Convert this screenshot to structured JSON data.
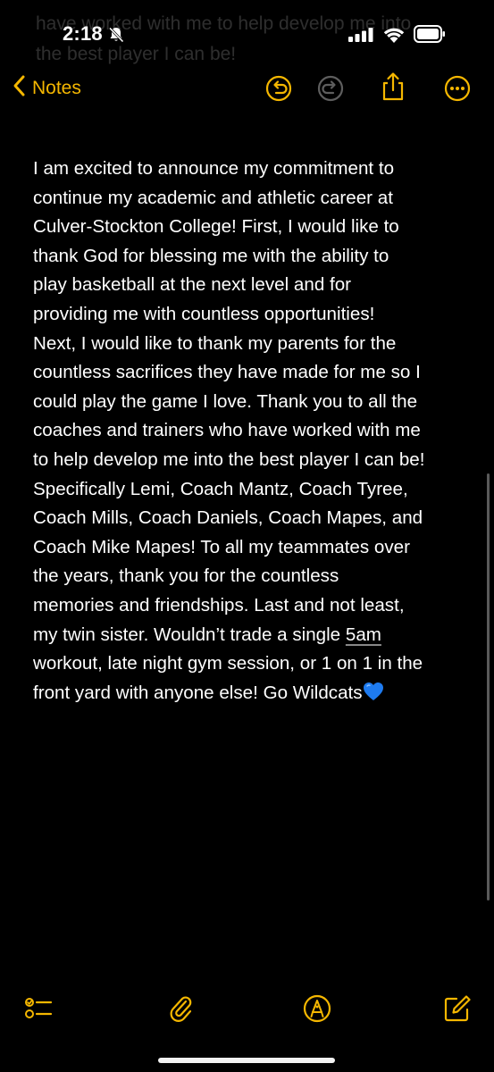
{
  "status_bar": {
    "time": "2:18"
  },
  "ghost_text": {
    "line1": "have worked with me to help develop me into",
    "line2": "the best player I can be!"
  },
  "nav": {
    "back_label": "Notes",
    "icons": [
      "undo-icon",
      "redo-icon",
      "share-icon",
      "more-icon"
    ]
  },
  "note": {
    "lines": [
      "I am excited to announce my commitment to",
      "continue my academic and athletic career at",
      "Culver-Stockton College! First, I would like to",
      "thank God for blessing me with the ability to",
      "play basketball at the next level and for",
      "providing me with countless opportunities!",
      "Next, I would like to thank my parents for the",
      "countless sacrifices they have made for me so I",
      "could play the game I love. Thank you to all the",
      "coaches and trainers who have worked with me",
      "to help develop me into the best player I can be!",
      "Specifically Lemi, Coach Mantz, Coach Tyree,",
      "Coach Mills, Coach Daniels, Coach Mapes, and",
      "Coach Mike Mapes! To all my teammates over",
      "the years, thank you for the countless",
      "memories and friendships. Last and not least,"
    ],
    "line17_before": "my twin sister. Wouldn’t trade a single ",
    "line17_underlined": "5am",
    "line18": "workout, late night gym session, or 1 on 1 in the",
    "line19": "front yard with anyone else! Go Wildcats"
  },
  "toolbar": {
    "icons": [
      "checklist-icon",
      "attachment-icon",
      "markup-icon",
      "compose-icon"
    ]
  },
  "colors": {
    "accent": "#f5b700",
    "background": "#000000",
    "text": "#ffffff"
  }
}
